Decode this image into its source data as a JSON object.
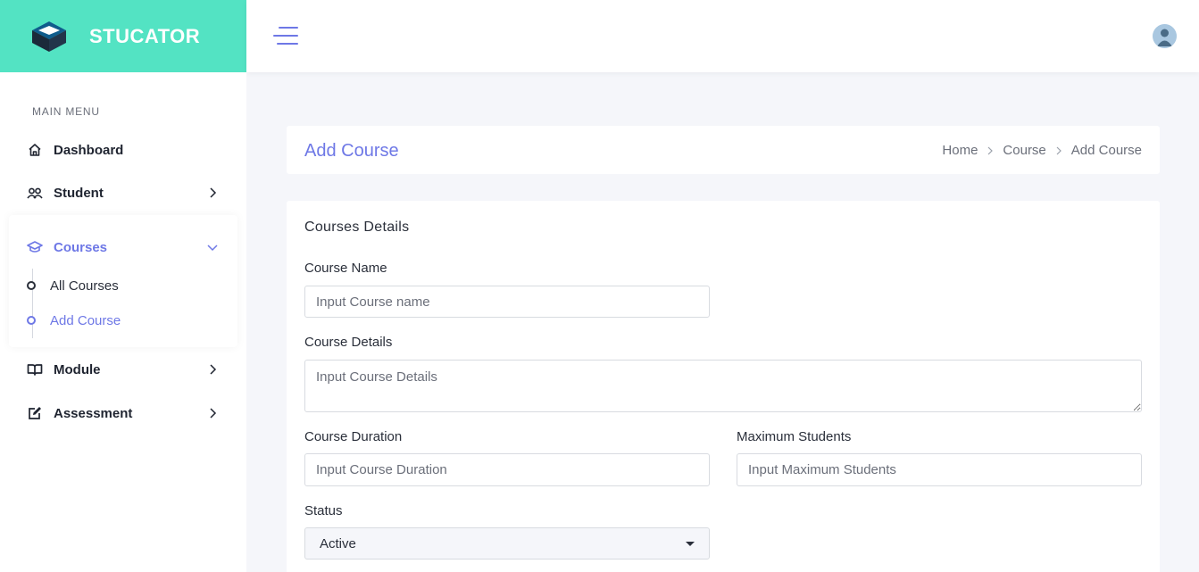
{
  "brand": {
    "name": "STUCATOR",
    "accent": "#53e3c3",
    "primary": "#6e78e6"
  },
  "topbar": {
    "menu_icon": "hamburger-icon",
    "avatar_icon": "user-avatar-icon"
  },
  "sidebar": {
    "menu_title": "MAIN MENU",
    "items": [
      {
        "label": "Dashboard",
        "icon": "home-icon"
      },
      {
        "label": "Student",
        "icon": "users-icon",
        "has_children": true
      },
      {
        "label": "Courses",
        "icon": "graduation-cap-icon",
        "expanded": true,
        "active": true,
        "children": [
          {
            "label": "All Courses",
            "active": false
          },
          {
            "label": "Add Course",
            "active": true
          }
        ]
      },
      {
        "label": "Module",
        "icon": "book-icon",
        "has_children": true
      },
      {
        "label": "Assessment",
        "icon": "edit-icon",
        "has_children": true
      }
    ]
  },
  "page": {
    "title": "Add Course",
    "breadcrumb": [
      "Home",
      "Course",
      "Add Course"
    ]
  },
  "form": {
    "title": "Courses Details",
    "course_name": {
      "label": "Course Name",
      "placeholder": "Input Course name",
      "value": ""
    },
    "course_details": {
      "label": "Course Details",
      "placeholder": "Input Course Details",
      "value": ""
    },
    "course_duration": {
      "label": "Course Duration",
      "placeholder": "Input Course Duration",
      "value": ""
    },
    "max_students": {
      "label": "Maximum Students",
      "placeholder": "Input Maximum Students",
      "value": ""
    },
    "status": {
      "label": "Status",
      "value": "Active"
    }
  }
}
